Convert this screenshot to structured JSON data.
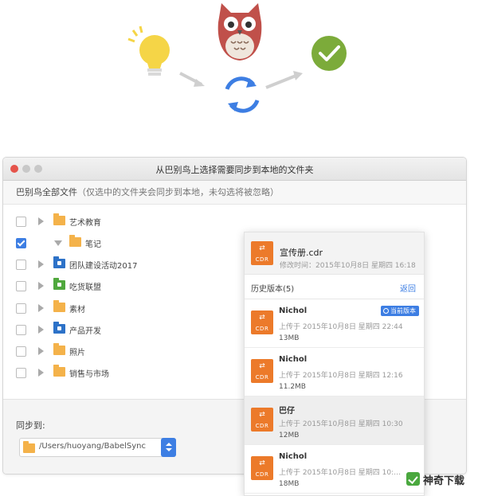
{
  "window": {
    "title": "从巴别鸟上选择需要同步到本地的文件夹",
    "root_label": "巴别鸟全部文件",
    "root_hint": "（仅选中的文件夹会同步到本地，未勾选将被忽略）"
  },
  "folders": [
    {
      "name": "艺术教育",
      "checked": false,
      "expanded": false,
      "indent": 0,
      "color": "#f4b24a"
    },
    {
      "name": "笔记",
      "checked": true,
      "expanded": true,
      "indent": 1,
      "color": "#f4b24a"
    },
    {
      "name": "团队建设活动2017",
      "checked": false,
      "expanded": false,
      "indent": 0,
      "color": "#2d72c8"
    },
    {
      "name": "吃货联盟",
      "checked": false,
      "expanded": false,
      "indent": 0,
      "color": "#4fa83d"
    },
    {
      "name": "素材",
      "checked": false,
      "expanded": false,
      "indent": 0,
      "color": "#f4b24a"
    },
    {
      "name": "产品开发",
      "checked": false,
      "expanded": false,
      "indent": 0,
      "color": "#2d72c8"
    },
    {
      "name": "照片",
      "checked": false,
      "expanded": false,
      "indent": 0,
      "color": "#f4b24a"
    },
    {
      "name": "销售与市场",
      "checked": false,
      "expanded": false,
      "indent": 0,
      "color": "#f4b24a"
    }
  ],
  "sync": {
    "label": "同步到:",
    "path": "/Users/huoyang/BabelSync"
  },
  "history_panel": {
    "file_name": "宣传册.cdr",
    "modified": "修改时间：2015年10月8日 星期四 16:18",
    "file_icon_ext": "CDR",
    "file_icon_symbol": "⇄",
    "history_title": "历史版本(5)",
    "back_label": "返回",
    "current_badge": "当前版本",
    "versions": [
      {
        "name": "Nichol",
        "time": "上传于 2015年10月8日 星期四 22:44",
        "size": "13MB",
        "current": true,
        "selected": false
      },
      {
        "name": "Nichol",
        "time": "上传于 2015年10月8日 星期四 12:16",
        "size": "11.2MB",
        "current": false,
        "selected": false
      },
      {
        "name": "巴仔",
        "time": "上传于 2015年10月8日 星期四 10:30",
        "size": "12MB",
        "current": false,
        "selected": true
      },
      {
        "name": "Nichol",
        "time": "上传于 2015年10月8日 星期四 10:…",
        "size": "18MB",
        "current": false,
        "selected": false
      }
    ]
  },
  "watermark": {
    "text": "神奇下载"
  },
  "colors": {
    "accent": "#3d7ee3",
    "cdr_orange": "#ec7a2a",
    "close_red": "#e5544b",
    "bulb_yellow": "#f5d547",
    "check_green": "#7cab3a",
    "owl_red": "#c0504a"
  },
  "icons": [
    "lightbulb-icon",
    "owl-mascot-icon",
    "sync-arrows-icon",
    "checkmark-circle-icon",
    "folder-icon",
    "cdr-file-icon",
    "chevron-updown-icon"
  ]
}
